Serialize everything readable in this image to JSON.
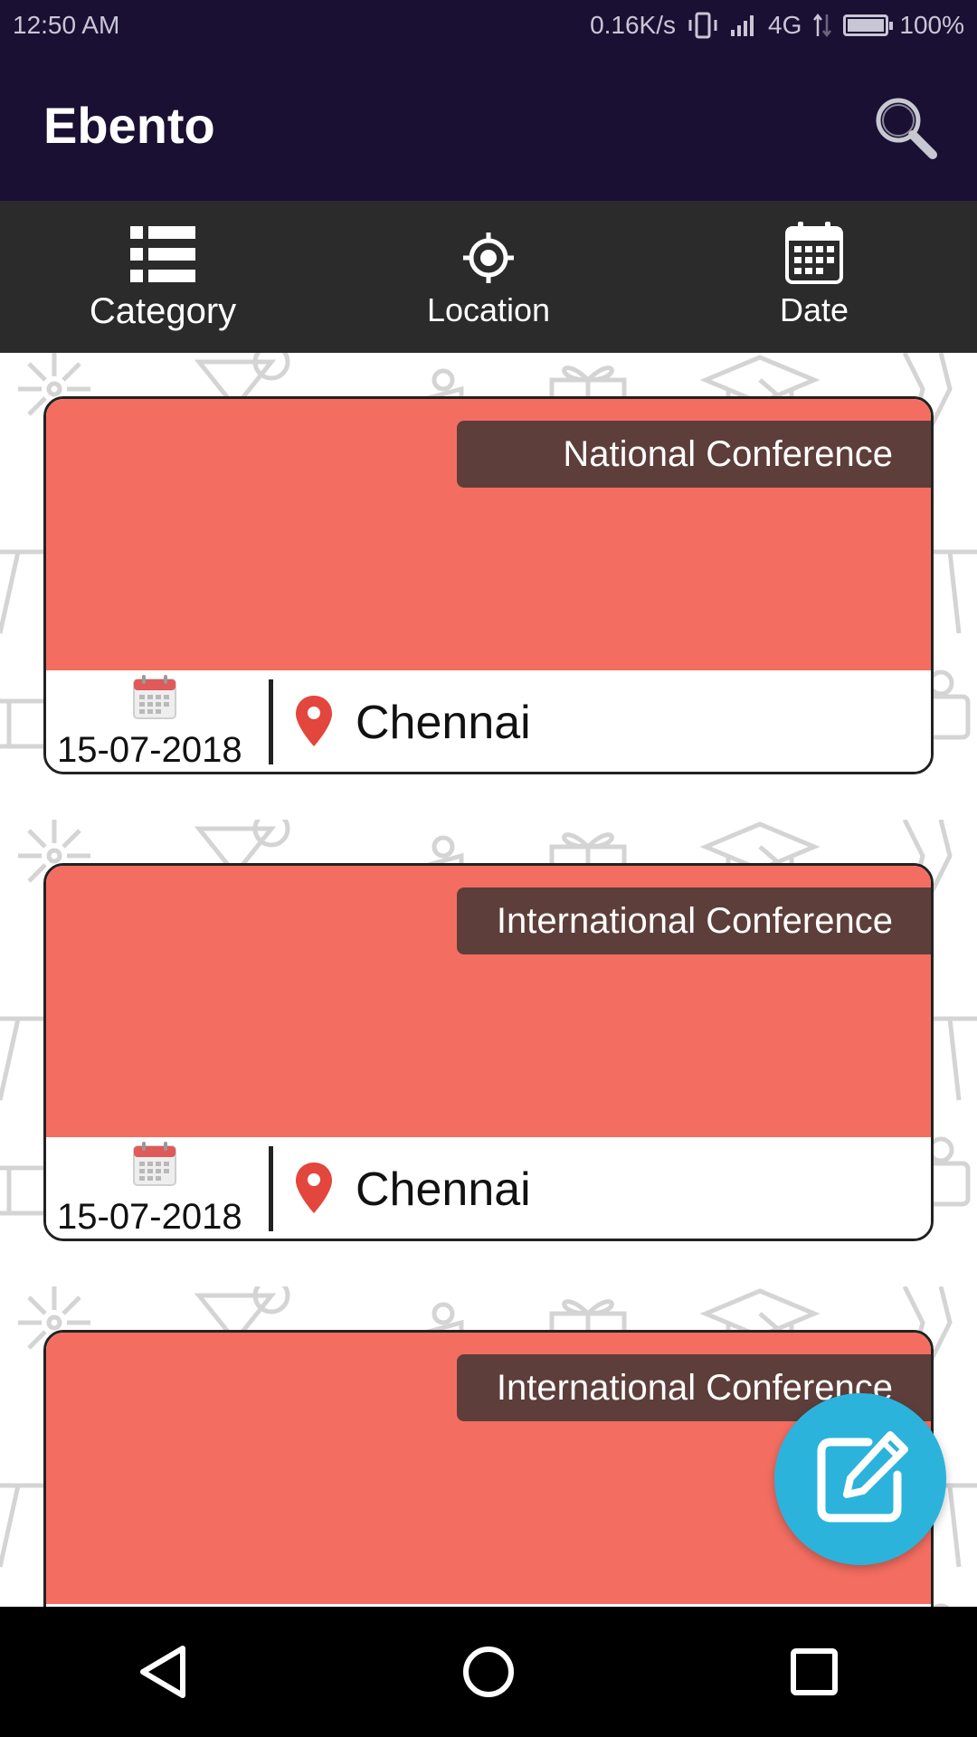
{
  "status_bar": {
    "time": "12:50 AM",
    "net_speed": "0.16K/s",
    "network": "4G",
    "battery": "100%",
    "battery_level": 1.0
  },
  "app_bar": {
    "title": "Ebento",
    "search_icon": "search-icon"
  },
  "filters": {
    "items": [
      {
        "label": "Category",
        "icon": "list-icon"
      },
      {
        "label": "Location",
        "icon": "target-icon"
      },
      {
        "label": "Date",
        "icon": "calendar-icon"
      }
    ]
  },
  "events": [
    {
      "category": "National Conference",
      "date": "15-07-2018",
      "city": "Chennai"
    },
    {
      "category": "International Conference",
      "date": "15-07-2018",
      "city": "Chennai"
    },
    {
      "category": "International Conference",
      "date": "",
      "city": ""
    }
  ],
  "fab": {
    "icon": "edit-icon"
  },
  "nav": {
    "items": [
      "back-icon",
      "home-icon",
      "recents-icon"
    ]
  },
  "colors": {
    "app_bar": "#1a1033",
    "filter_bar": "#2b2b2b",
    "banner": "#f36e61",
    "tag": "#5e3e3a",
    "fab": "#2bb3dc"
  }
}
